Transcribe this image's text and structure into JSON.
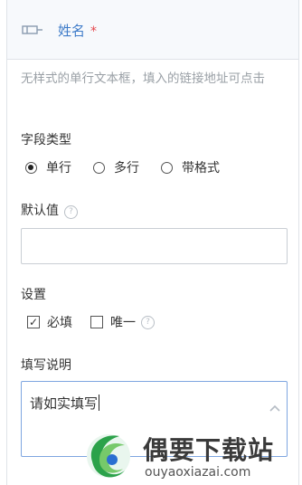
{
  "field": {
    "name": "姓名",
    "required_mark": "*",
    "hint": "无样式的单行文本框，填入的链接地址可点击"
  },
  "field_type": {
    "label": "字段类型",
    "options": [
      {
        "label": "单行",
        "selected": true
      },
      {
        "label": "多行",
        "selected": false
      },
      {
        "label": "带格式",
        "selected": false
      }
    ]
  },
  "default_value": {
    "label": "默认值",
    "help": "?",
    "value": ""
  },
  "settings": {
    "label": "设置",
    "required": {
      "label": "必填",
      "checked": true
    },
    "unique": {
      "label": "唯一",
      "checked": false,
      "help": "?"
    }
  },
  "instructions": {
    "label": "填写说明",
    "value": "请如实填写"
  },
  "watermark": {
    "title": "偶要下载站",
    "url": "ouyaoxiazai.com"
  },
  "colors": {
    "accent": "#3f7cc9",
    "required": "#e5484d",
    "hint": "#9aa0a6",
    "focus_border": "#7ea6e0"
  }
}
